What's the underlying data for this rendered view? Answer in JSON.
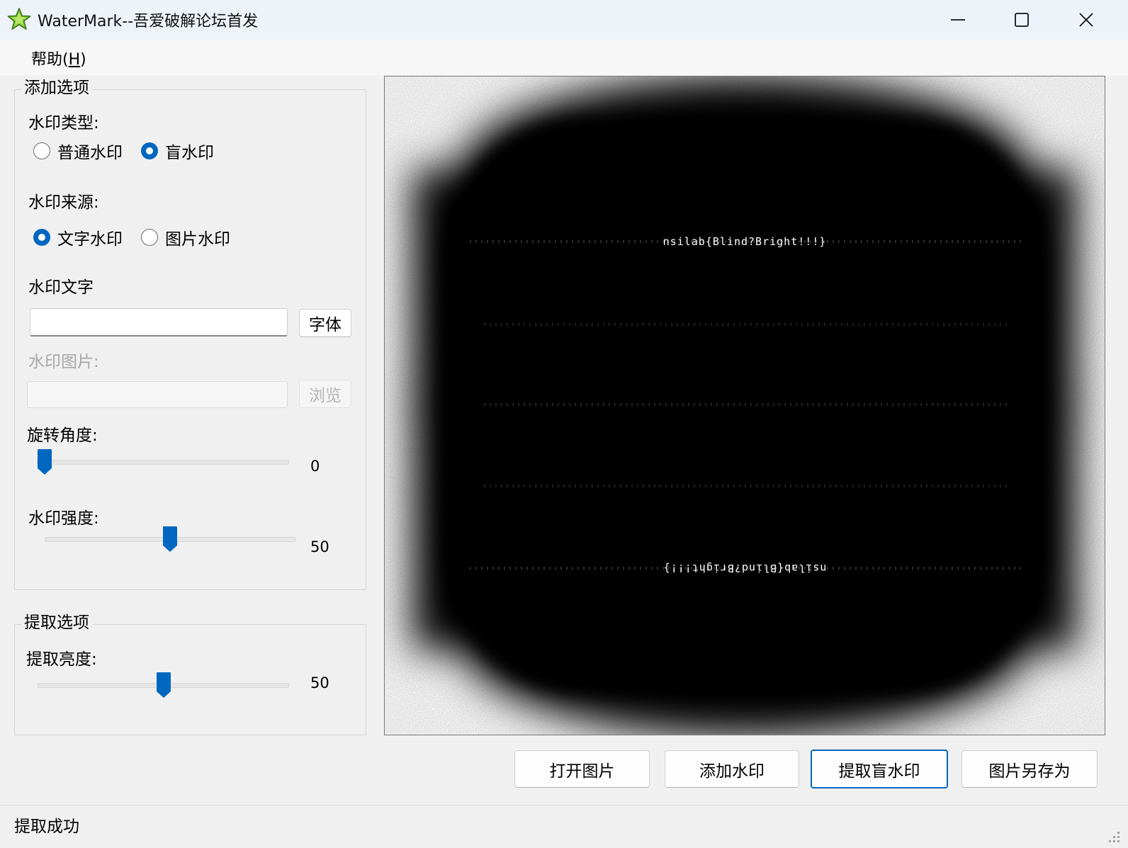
{
  "window": {
    "title": "WaterMark--吾爱破解论坛首发"
  },
  "icons": [
    "star-icon",
    "minimize-icon",
    "maximize-icon",
    "close-icon",
    "resize-grip-icon"
  ],
  "menu": {
    "help_label": "帮助(",
    "help_key": "H",
    "help_close": ")"
  },
  "add_options": {
    "title": "添加选项",
    "type_label": "水印类型:",
    "type_options": [
      {
        "label": "普通水印",
        "checked": false
      },
      {
        "label": "盲水印",
        "checked": true
      }
    ],
    "source_label": "水印来源:",
    "source_options": [
      {
        "label": "文字水印",
        "checked": true
      },
      {
        "label": "图片水印",
        "checked": false
      }
    ],
    "text_label": "水印文字",
    "text_value": "",
    "font_button": "字体",
    "image_label": "水印图片:",
    "image_value": "",
    "browse_button": "浏览",
    "rotation_label": "旋转角度:",
    "rotation_value": "0",
    "rotation_range": [
      0,
      360
    ],
    "strength_label": "水印强度:",
    "strength_value": "50",
    "strength_range": [
      0,
      100
    ]
  },
  "extract_options": {
    "title": "提取选项",
    "brightness_label": "提取亮度:",
    "brightness_value": "50",
    "brightness_range": [
      0,
      100
    ]
  },
  "preview": {
    "watermark_text": "nsilab{Blind?Bright!!!}",
    "colors": {
      "background": "#ffffff",
      "spectrum": "#000000",
      "text": "#ffffff"
    }
  },
  "actions": {
    "open": "打开图片",
    "add": "添加水印",
    "extract": "提取盲水印",
    "save_as": "图片另存为"
  },
  "status": {
    "text": "提取成功"
  },
  "colors": {
    "accent": "#0067c0",
    "titlebar": "#eef3fa",
    "window": "#f0f0f0"
  }
}
